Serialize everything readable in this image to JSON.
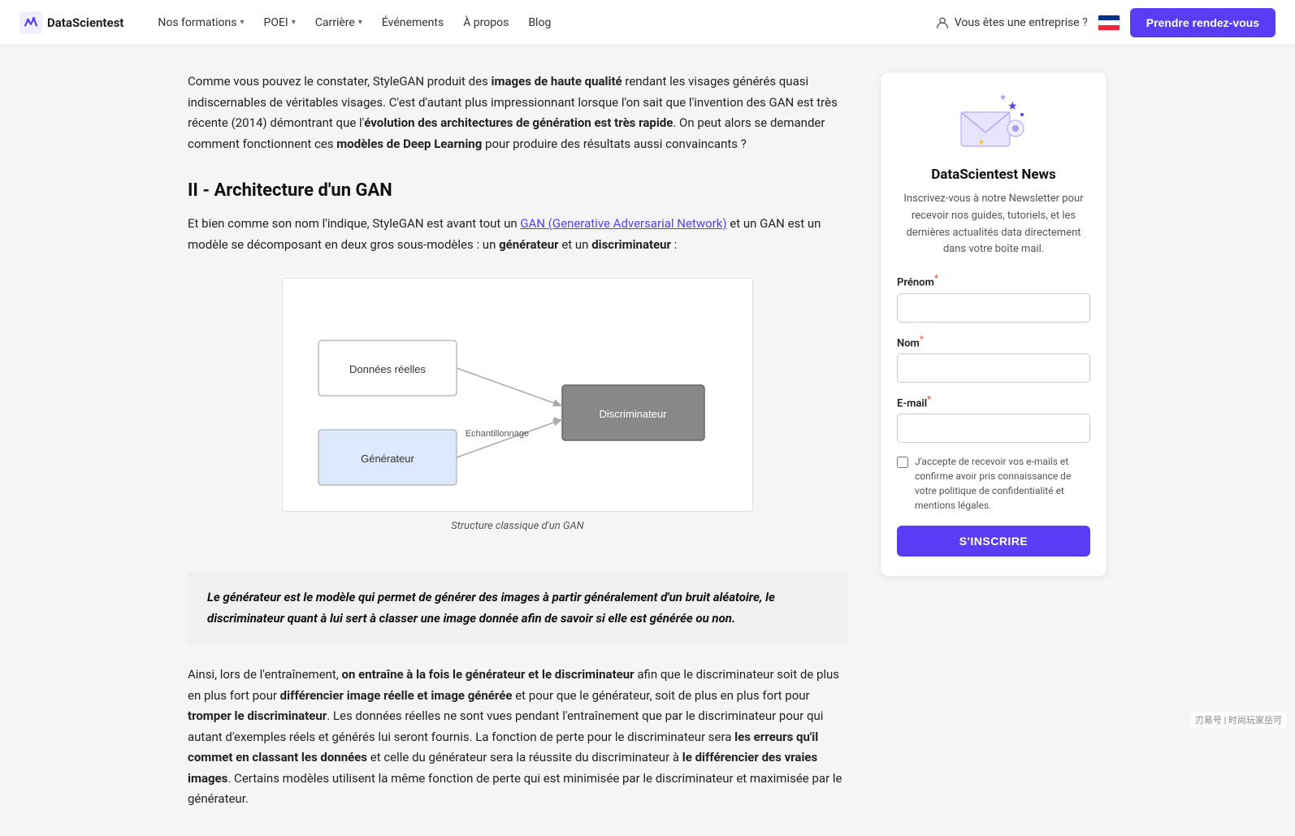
{
  "nav": {
    "logo_text": "DataScientest",
    "links": [
      {
        "label": "Nos formations",
        "has_dropdown": true
      },
      {
        "label": "POEI",
        "has_dropdown": true
      },
      {
        "label": "Carrière",
        "has_dropdown": true
      },
      {
        "label": "Événements",
        "has_dropdown": false
      },
      {
        "label": "À propos",
        "has_dropdown": false
      },
      {
        "label": "Blog",
        "has_dropdown": false
      }
    ],
    "enterprise_label": "Vous êtes une entreprise ?",
    "cta_label": "Prendre rendez-vous"
  },
  "main": {
    "intro_paragraph": "Comme vous pouvez le constater, StyleGAN produit des images de haute qualité rendant les visages générés quasi indiscernables de véritables visages. C'est d'autant plus impressionnant lorsque l'on sait que l'invention des GAN est très récente (2014) démontrant que l'évolution des architectures de génération est très rapide. On peut alors se demander comment fonctionnent ces modèles de Deep Learning pour produire des résultats aussi convaincants ?",
    "intro_bold_parts": [
      "images de haute qualité",
      "évolution des architectures de génération est très rapide",
      "modèles de Deep Learning"
    ],
    "section_title": "II - Architecture d'un GAN",
    "section_intro": "Et bien comme son nom l'indique, StyleGAN est avant tout un GAN (Generative Adversarial Network) et un GAN est un modèle se décomposant en deux gros sous-modèles : un générateur et un discriminateur :",
    "gan_link_text": "GAN (Generative Adversarial Network)",
    "diagram_caption": "Structure classique d'un GAN",
    "diagram": {
      "box_donnees": "Données réelles",
      "box_generateur": "Générateur",
      "box_discriminateur": "Discriminateur",
      "label_echantillonnage": "Echantillonnage"
    },
    "highlighted_text": "Le générateur est le modèle qui permet de générer des images à partir généralement d'un bruit aléatoire, le discriminateur quant à lui sert à classer une image donnée afin de savoir si elle est générée ou non.",
    "body_text_1": "Ainsi, lors de l'entraînement, on entraîne à la fois le générateur et le discriminateur afin que le discriminateur soit de plus en plus fort pour différencier image réelle et image générée et pour que le générateur, soit de plus en plus fort pour tromper le discriminateur. Les données réelles ne sont vues pendant l'entraînement que par le discriminateur pour qui autant d'exemples réels et générés lui seront fournis. La fonction de perte pour le discriminateur sera les erreurs qu'il commet en classant les données et celle du générateur sera la réussite du discriminateur à le différencier des vraies images. Certains modèles utilisent la même fonction de perte qui est minimisée par le discriminateur et maximisée par le générateur.",
    "body_bold_parts": [
      "on entraîne à la fois le générateur et le discriminateur",
      "différencier image réelle et image générée",
      "tromper le discriminateur",
      "les erreurs qu'il commet en classant les données",
      "le différencier des vraies images"
    ]
  },
  "sidebar": {
    "newsletter_title": "DataScientest News",
    "newsletter_desc": "Inscrivez-vous à notre Newsletter pour recevoir nos guides, tutoriels, et les dernières actualités data directement dans votre boîte mail.",
    "prenom_label": "Prénom",
    "nom_label": "Nom",
    "email_label": "E-mail",
    "checkbox_label": "J'accepte de recevoir vos e-mails et confirme avoir pris connaissance de votre politique de confidentialité et mentions légales.",
    "subscribe_button": "S'INSCRIRE"
  },
  "watermark": "刃易号 | 时尚玩家岳可"
}
